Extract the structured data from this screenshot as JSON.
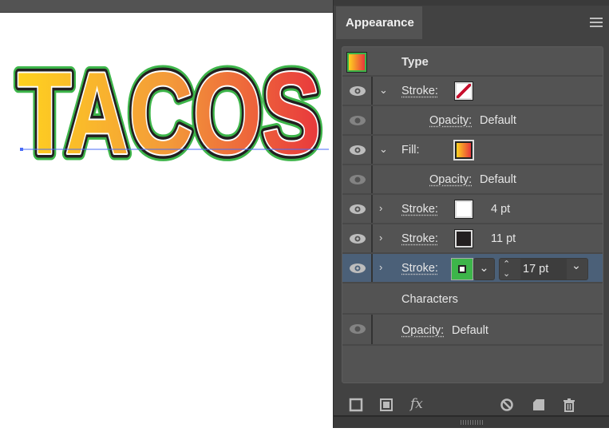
{
  "canvas": {
    "artwork_text": "TACOS",
    "colors": {
      "gradient_start": "#ffd21f",
      "gradient_end": "#e8373c",
      "inner_stroke": "#ffffff",
      "middle_stroke": "#231f20",
      "outer_stroke": "#3db54a",
      "selection_line": "#4a6cf7"
    }
  },
  "panel": {
    "tab": "Appearance",
    "menu_icon": "hamburger-icon",
    "rows": [
      {
        "title": "Type"
      },
      {
        "label": "Stroke:",
        "swatch": "none"
      },
      {
        "label": "Opacity:",
        "value": "Default"
      },
      {
        "label": "Fill:",
        "swatch": "gradient"
      },
      {
        "label": "Opacity:",
        "value": "Default"
      },
      {
        "label": "Stroke:",
        "swatch": "#ffffff",
        "value": "4 pt"
      },
      {
        "label": "Stroke:",
        "swatch": "#231f20",
        "value": "11 pt"
      },
      {
        "label": "Stroke:",
        "swatch": "#3db54a",
        "value": "17 pt",
        "selected": true
      },
      {
        "title": "Characters"
      },
      {
        "label": "Opacity:",
        "value": "Default"
      }
    ],
    "toolbar": [
      "add-new-stroke-icon",
      "add-new-fill-icon",
      "fx-icon",
      "clear-appearance-icon",
      "duplicate-item-icon",
      "delete-icon"
    ],
    "fx_label": "fx"
  }
}
